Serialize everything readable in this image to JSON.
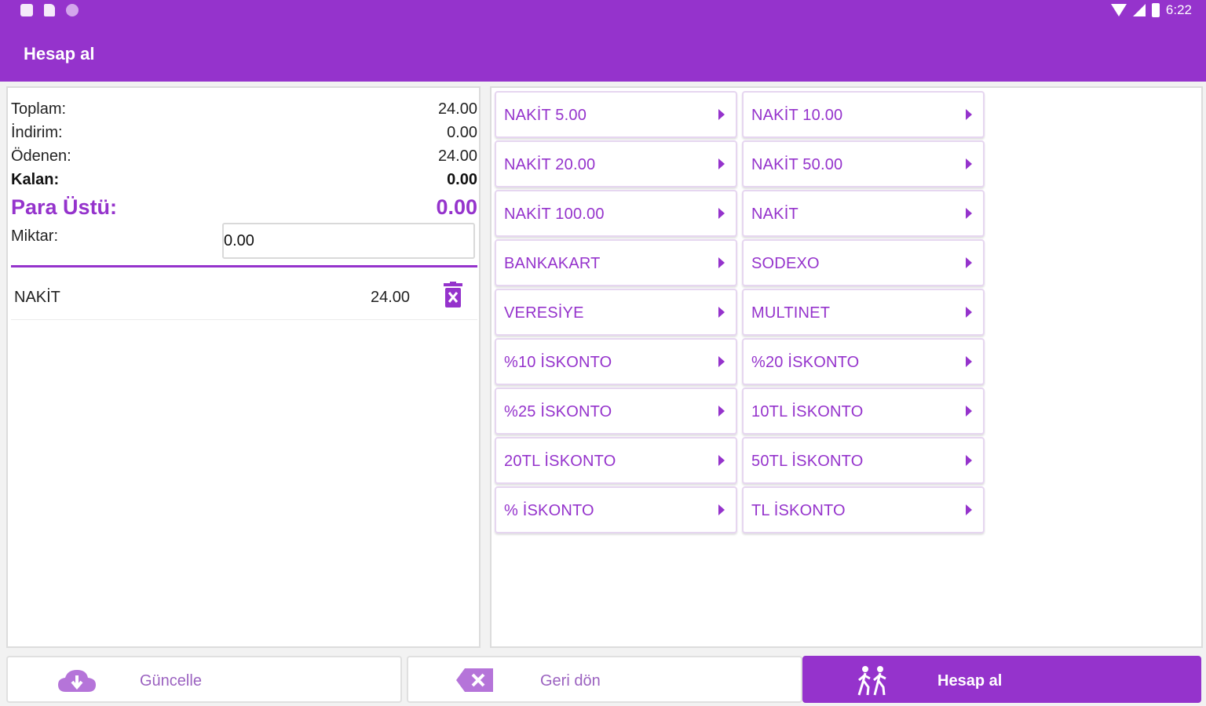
{
  "app": {
    "title": "Hesap al",
    "status_time": "6:22"
  },
  "summary": {
    "toplam_label": "Toplam:",
    "toplam_value": "24.00",
    "indirim_label": "İndirim:",
    "indirim_value": "0.00",
    "odenen_label": "Ödenen:",
    "odenen_value": "24.00",
    "kalan_label": "Kalan:",
    "kalan_value": "0.00",
    "para_ustu_label": "Para Üstü:",
    "para_ustu_value": "0.00",
    "miktar_label": "Miktar:",
    "miktar_value": "0.00"
  },
  "payments": [
    {
      "name": "NAKİT",
      "amount": "24.00"
    }
  ],
  "payment_buttons": [
    "NAKİT 5.00",
    "NAKİT 10.00",
    "NAKİT 20.00",
    "NAKİT 50.00",
    "NAKİT 100.00",
    "NAKİT",
    "BANKAKART",
    "SODEXO",
    "VERESİYE",
    "MULTINET",
    "%10 İSKONTO",
    "%20 İSKONTO",
    "%25 İSKONTO",
    "10TL İSKONTO",
    "20TL İSKONTO",
    "50TL İSKONTO",
    "% İSKONTO",
    "TL İSKONTO"
  ],
  "bottom": {
    "update_label": "Güncelle",
    "back_label": "Geri dön",
    "checkout_label": "Hesap al"
  },
  "colors": {
    "accent": "#9533cc",
    "accent_light": "#e6d6f0"
  },
  "icons": {
    "update": "cloud-download-icon",
    "back": "backspace-icon",
    "checkout": "people-walking-icon",
    "delete": "trash-icon",
    "arrow": "chevron-right-icon"
  }
}
